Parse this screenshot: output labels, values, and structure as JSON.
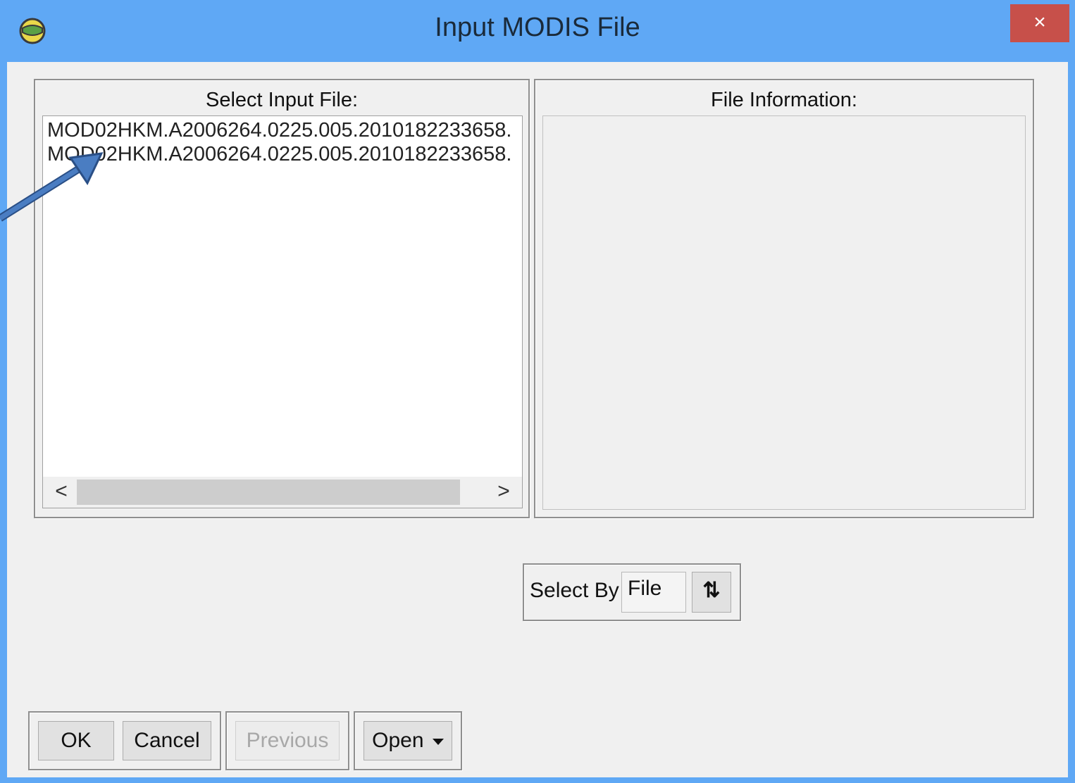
{
  "window": {
    "title": "Input MODIS File",
    "close_glyph": "×",
    "icon": "app-globe-icon"
  },
  "left_panel": {
    "label": "Select Input File:",
    "files": [
      "MOD02HKM.A2006264.0225.005.2010182233658.",
      "MOD02HKM.A2006264.0225.005.2010182233658."
    ],
    "scroll_left": "<",
    "scroll_right": ">"
  },
  "right_panel": {
    "label": "File Information:"
  },
  "select_by": {
    "label": "Select By",
    "value": "File",
    "sort_icon": "sort-arrows-icon",
    "sort_glyph": "⇅"
  },
  "buttons": {
    "ok": "OK",
    "cancel": "Cancel",
    "previous": "Previous",
    "open": "Open"
  },
  "colors": {
    "titlebar": "#5fa8f5",
    "close": "#c7504a",
    "client": "#f0f0f0",
    "arrow": "#3a6aa8"
  }
}
